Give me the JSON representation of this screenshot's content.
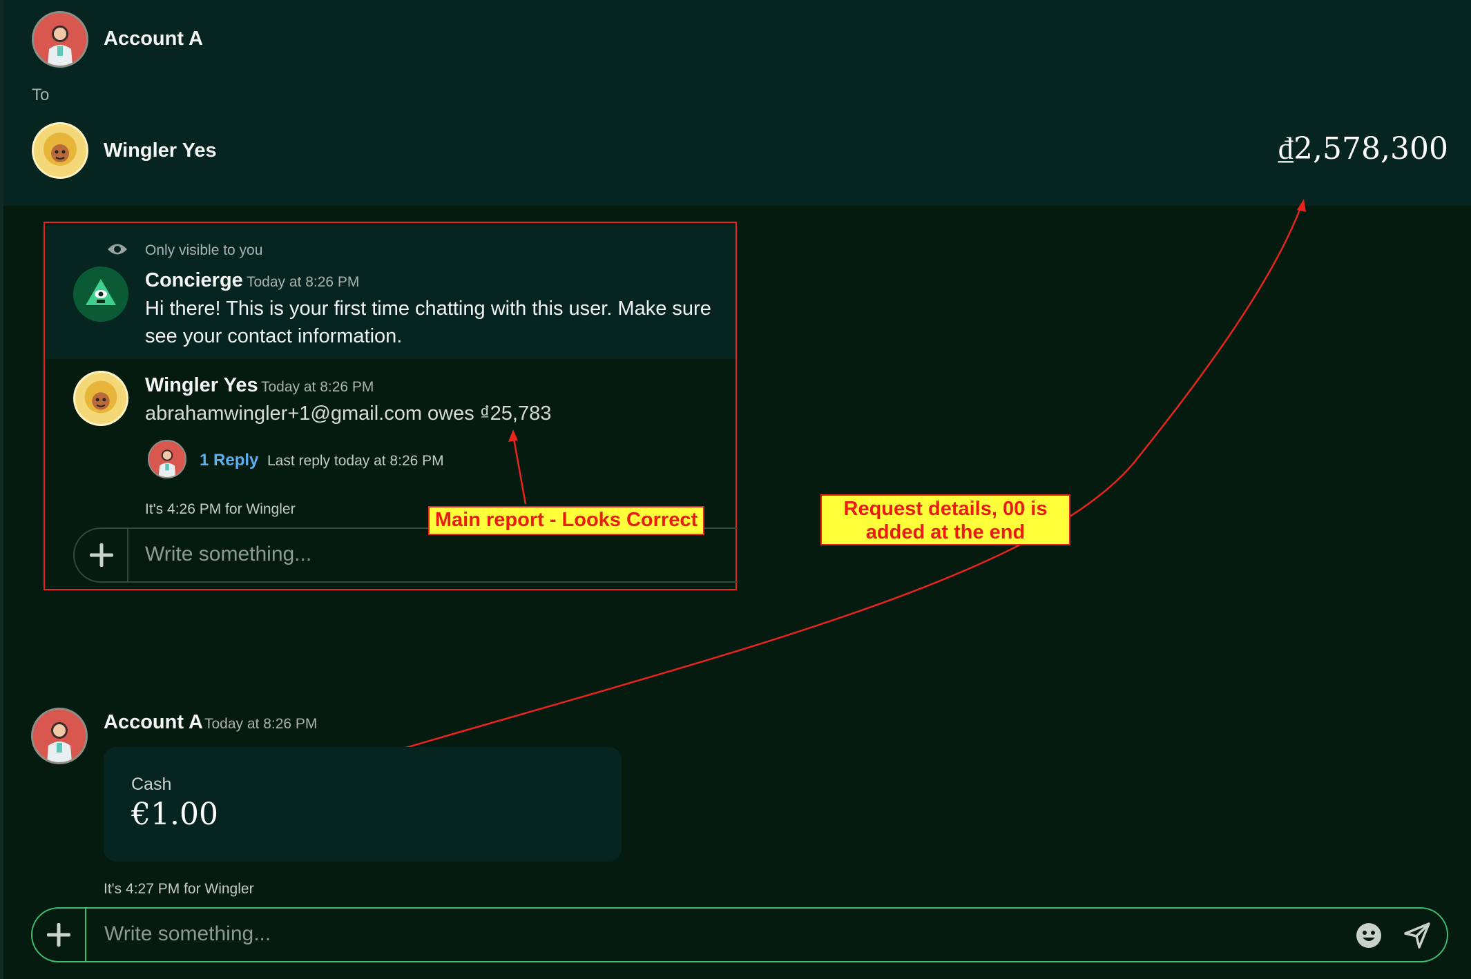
{
  "header": {
    "from_name": "Account A",
    "to_label": "To",
    "to_name": "Wingler Yes",
    "amount": "₫2,578,300"
  },
  "concierge": {
    "visibility_note": "Only visible to you",
    "name": "Concierge",
    "time": "Today at 8:26 PM",
    "text": "Hi there! This is your first time chatting with this user. Make sure see your contact information."
  },
  "report_message": {
    "name": "Wingler Yes",
    "time": "Today at 8:26 PM",
    "text": "abrahamwingler+1@gmail.com owes ₫25,783",
    "reply_count": "1 Reply",
    "last_reply": "Last reply today at 8:26 PM",
    "local_time": "It's 4:26 PM for Wingler"
  },
  "thread_composer": {
    "placeholder": "Write something..."
  },
  "request_message": {
    "name": "Account A",
    "time": "Today at 8:26 PM",
    "card_label": "Cash",
    "card_amount": "€1.00",
    "local_time": "It's 4:27 PM for Wingler"
  },
  "main_composer": {
    "placeholder": "Write something..."
  },
  "annotations": {
    "main_report": "Main report - Looks Correct",
    "request_details": "Request details, 00 is added at the end",
    "color": "#ea1c12"
  }
}
